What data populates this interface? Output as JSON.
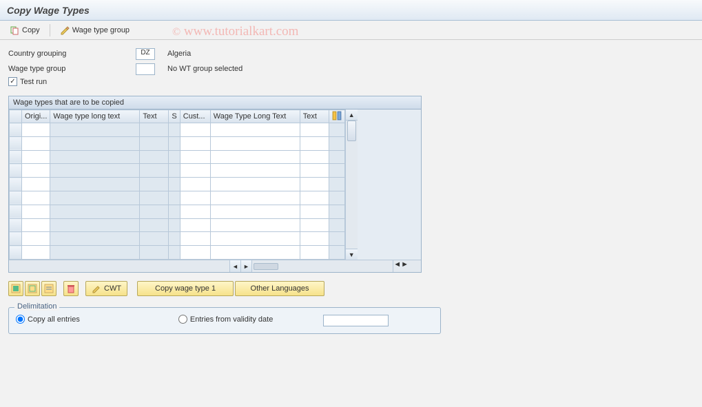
{
  "title": "Copy Wage Types",
  "toolbar": {
    "copy_label": "Copy",
    "wage_group_label": "Wage type group"
  },
  "watermark": "© www.tutorialkart.com",
  "form": {
    "country_grouping_label": "Country grouping",
    "country_grouping_value": "DZ",
    "country_name": "Algeria",
    "wage_type_group_label": "Wage type group",
    "wage_type_group_value": "",
    "wage_type_group_text": "No WT group selected",
    "test_run_label": "Test run",
    "test_run_checked": true
  },
  "table": {
    "title": "Wage types that are to be copied",
    "cols": {
      "origi": "Origi...",
      "wt_long": "Wage type long text",
      "text": "Text",
      "s": "S",
      "cust": "Cust...",
      "wt_long2": "Wage Type Long Text",
      "text2": "Text"
    },
    "row_count": 10
  },
  "buttons": {
    "cwt": "CWT",
    "copy_wt1": "Copy wage type 1",
    "other_lang": "Other Languages"
  },
  "delimitation": {
    "title": "Delimitation",
    "copy_all": "Copy all entries",
    "from_date": "Entries from validity date",
    "selected": "copy_all",
    "date_value": ""
  }
}
